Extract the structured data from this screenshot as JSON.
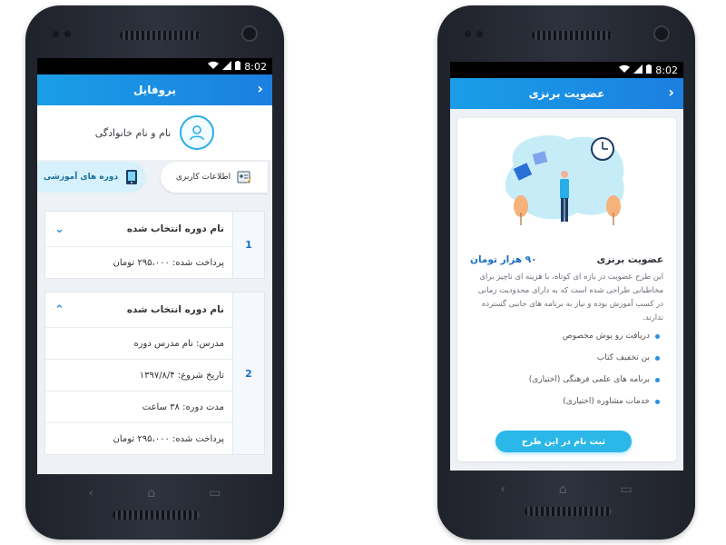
{
  "status": {
    "time": "8:02"
  },
  "profile_screen": {
    "title": "پروفایل",
    "user_name": "نام و نام خانوادگی",
    "tabs": {
      "user_info": "اطلاعات کاربری",
      "courses": "دوره های آموزشی"
    },
    "courses": [
      {
        "number": "1",
        "title": "نام دوره انتخاب شده",
        "expanded": false,
        "rows": [
          "پرداخت شده: ۲۹۵،۰۰۰ تومان"
        ]
      },
      {
        "number": "2",
        "title": "نام دوره انتخاب شده",
        "expanded": true,
        "rows": [
          "مدرس: نام مدرس دوره",
          "تاریخ شروع: ۱۳۹۷/۸/۴",
          "مدت دوره: ۳۸ ساعت",
          "پرداخت شده: ۲۹۵،۰۰۰ تومان"
        ]
      }
    ]
  },
  "plan_screen": {
    "title": "عضویت برنزی",
    "plan_name": "عضویت برنزی",
    "price": "۹۰ هزار تومان",
    "description": "این طرح عضویت در بازه ای کوتاه، با هزینه ای ناچیز برای مخاطبانی طراحی شده است که به دارای محدودیت زمانی در کسب آموزش بوده و نیاز به برنامه های جانبی گسترده ندارند.",
    "features": [
      "دریافت رو پوش مخصوص",
      "بن تخفیف کتاب",
      "برنامه های علمی فرهنگی (اختیاری)",
      "خدمات مشاوره (اختیاری)"
    ],
    "cta": "ثبت نام در این طرح"
  },
  "colors": {
    "accent": "#1b8fe6",
    "cta": "#2bb7e8",
    "tab_active": "#d6f1fb"
  }
}
